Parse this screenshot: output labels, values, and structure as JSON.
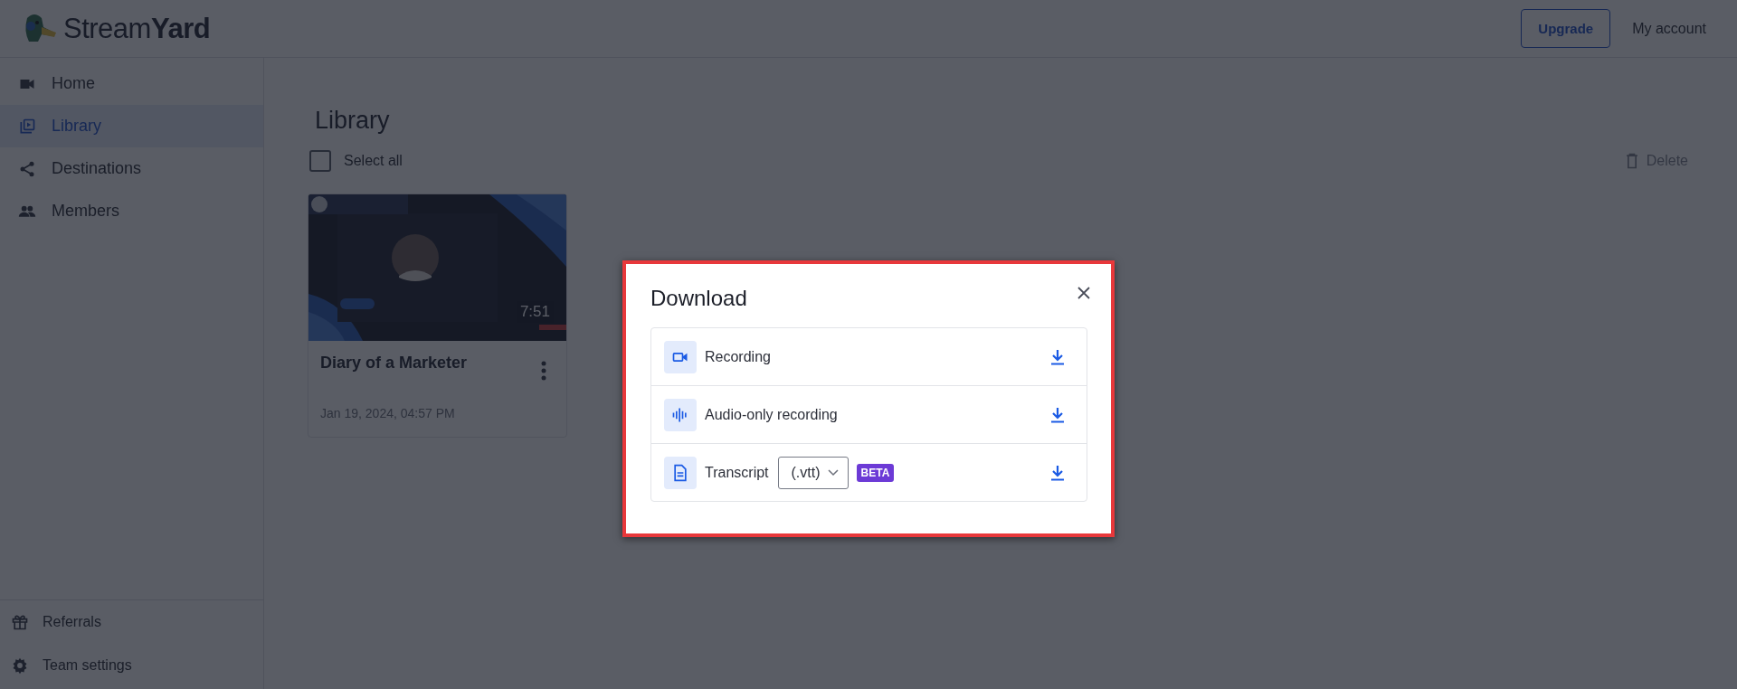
{
  "header": {
    "logo": "Stream**Yard**",
    "upgrade": "Upgrade",
    "account": "My account"
  },
  "sidebar": {
    "items": [
      {
        "label": "Home",
        "selected": false
      },
      {
        "label": "Library",
        "selected": true
      },
      {
        "label": "Destinations",
        "selected": false
      },
      {
        "label": "Members",
        "selected": false
      }
    ],
    "footer_items": [
      {
        "label": "Referrals"
      },
      {
        "label": "Team settings"
      }
    ]
  },
  "main": {
    "title": "Library",
    "select_all": {
      "label": "Select all",
      "checked": false
    },
    "delete": {
      "label": "Delete",
      "disabled": true
    },
    "recordings": [
      {
        "kind": "picture",
        "duration": "7:51",
        "title": "Diary of a Marketer",
        "date": "Jan 19, 2024, 04:57 PM"
      }
    ]
  },
  "modal": {
    "title": "Download",
    "options": [
      {
        "kind": "video",
        "label": "Recording"
      },
      {
        "kind": "audio",
        "label": "Audio-only recording"
      },
      {
        "kind": "transcript",
        "label": "Transcript",
        "format": "(.vtt)",
        "badge": "BETA"
      }
    ]
  }
}
